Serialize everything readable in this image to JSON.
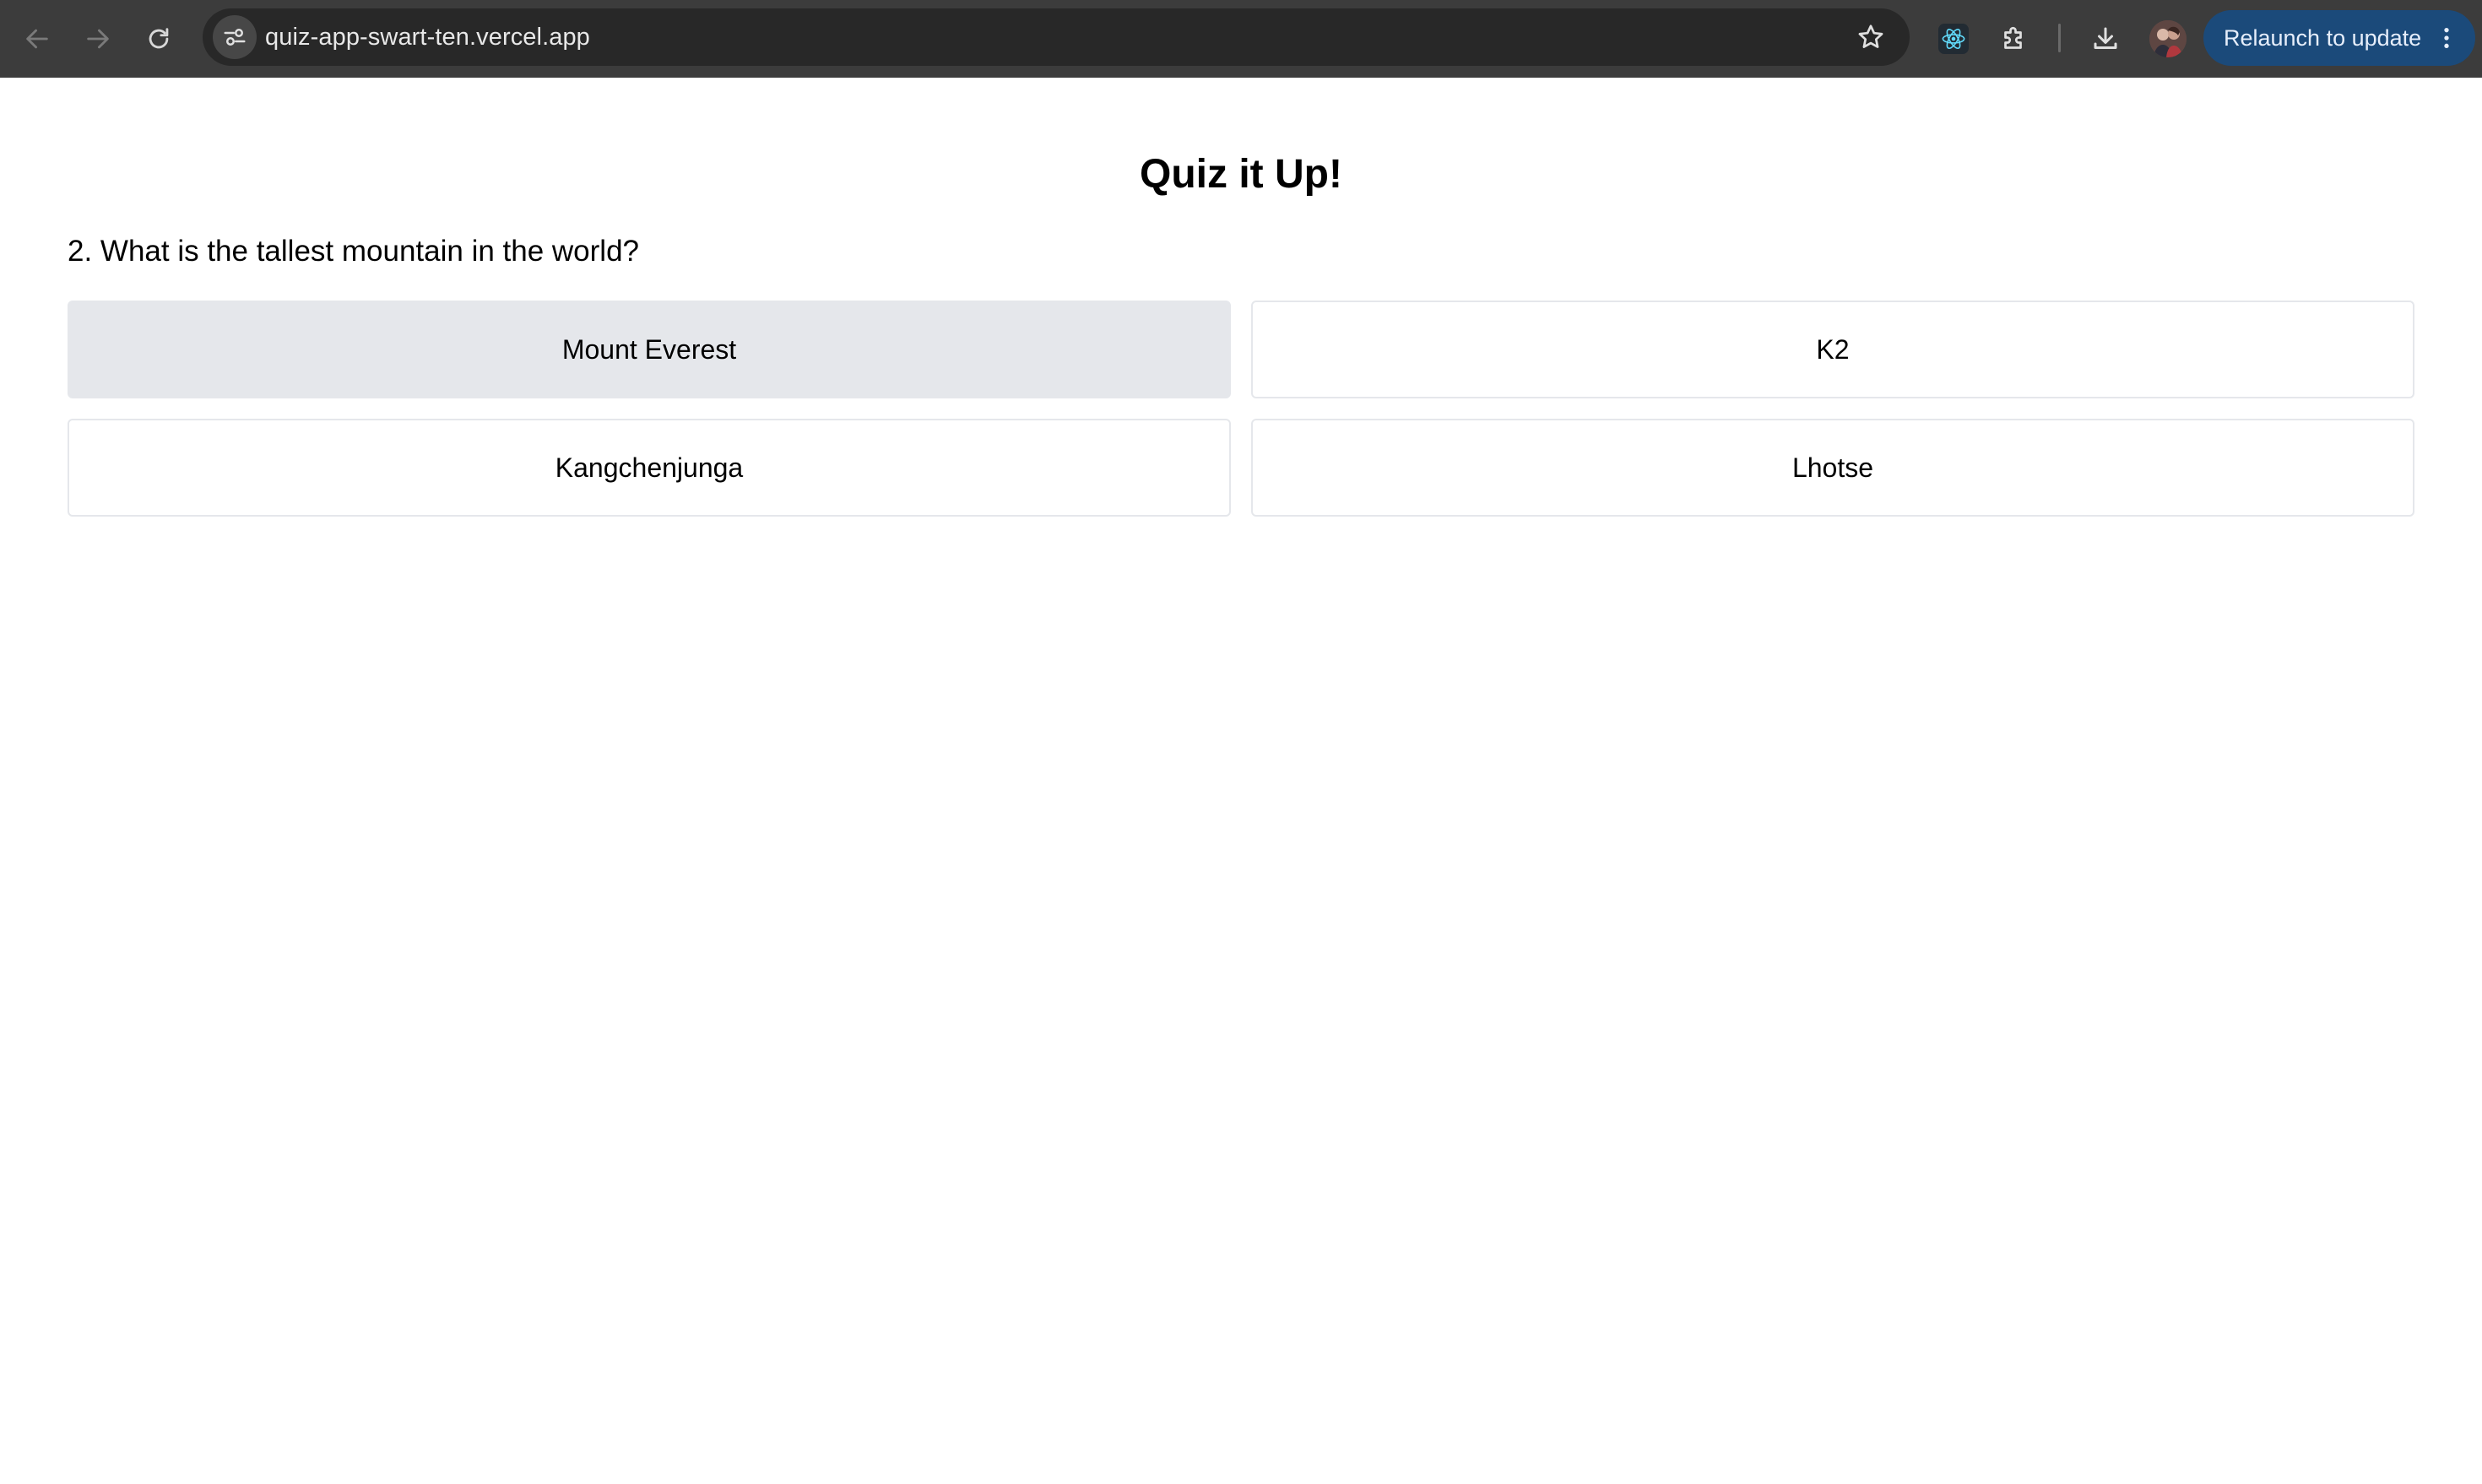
{
  "browser": {
    "url": "quiz-app-swart-ten.vercel.app",
    "relaunch_label": "Relaunch to update",
    "icons": {
      "back": "arrow-left-icon",
      "forward": "arrow-right-icon",
      "reload": "reload-icon",
      "site_info": "tune-icon",
      "bookmark": "star-icon",
      "react_devtools": "react-icon",
      "extensions": "puzzle-icon",
      "downloads": "download-icon",
      "menu": "kebab-icon"
    },
    "colors": {
      "toolbar": "#3c3c3c",
      "omnibox": "#282828",
      "relaunch_bg": "#1b4a7a",
      "react_icon": "#61dafb"
    }
  },
  "quiz": {
    "title": "Quiz it Up!",
    "question": "2. What is the tallest mountain in the world?",
    "options": [
      {
        "label": "Mount Everest",
        "hovered": true
      },
      {
        "label": "K2",
        "hovered": false
      },
      {
        "label": "Kangchenjunga",
        "hovered": false
      },
      {
        "label": "Lhotse",
        "hovered": false
      }
    ],
    "colors": {
      "option_border": "#e5e7eb",
      "option_hover_bg": "#e5e7eb"
    }
  }
}
